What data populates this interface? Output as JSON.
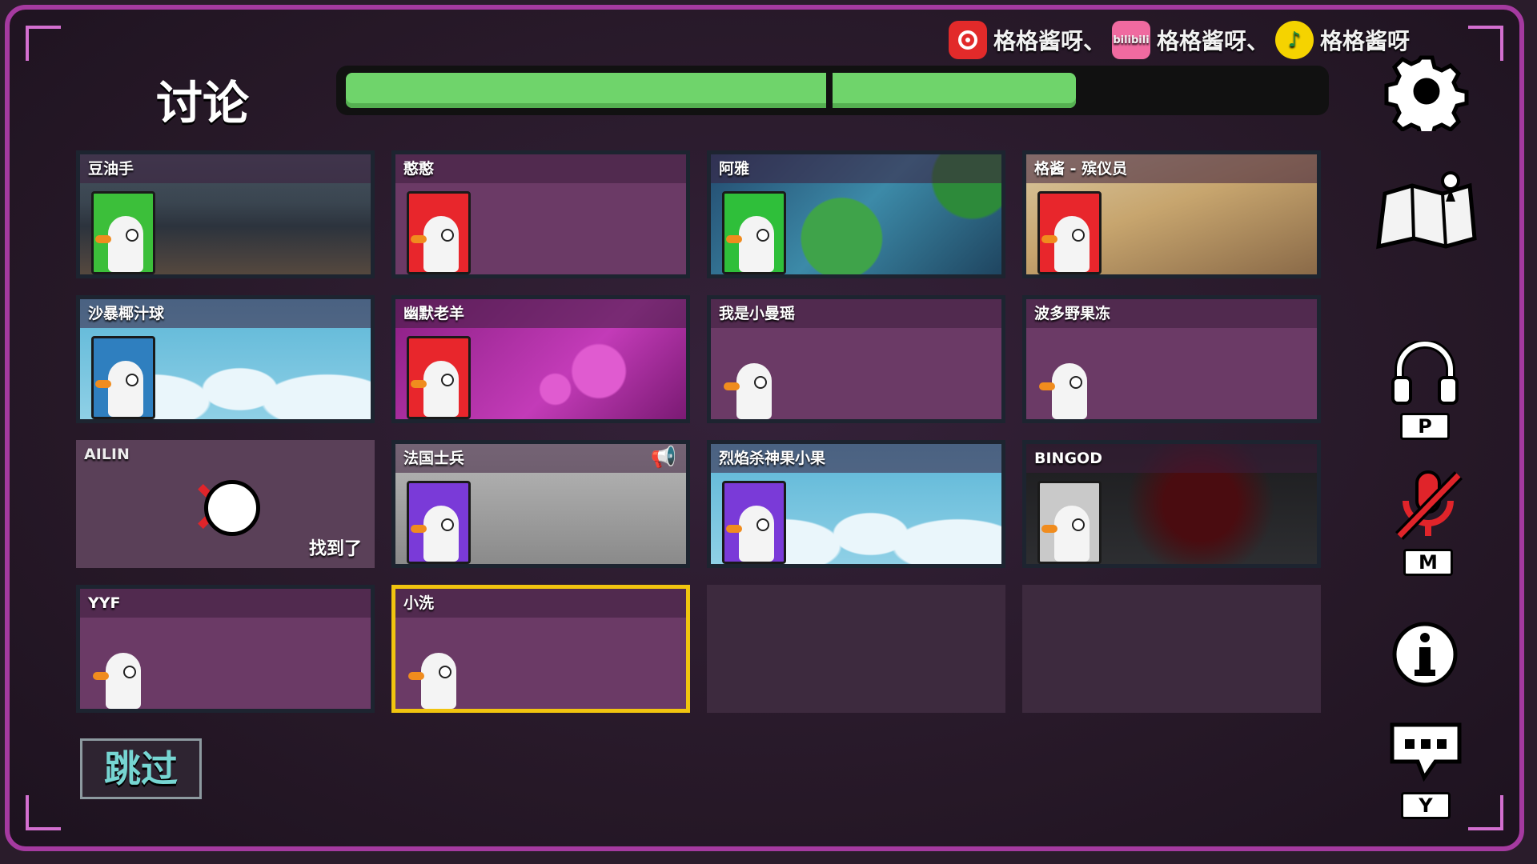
{
  "streamer_bar": {
    "entries": [
      {
        "logo": "netease-music-icon",
        "text": "格格酱呀、"
      },
      {
        "logo": "bilibili-icon",
        "logo_text": "bilibili",
        "text": "格格酱呀、"
      },
      {
        "logo": "qq-music-icon",
        "text": "格格酱呀"
      }
    ]
  },
  "header": {
    "title": "讨论",
    "timer_progress": 0.75
  },
  "players": [
    {
      "name": "豆油手",
      "bg": "room",
      "portrait_color": "#3cbf3a",
      "status": "alive"
    },
    {
      "name": "憨憨",
      "bg": "plain",
      "portrait_color": "#e8262c",
      "status": "alive"
    },
    {
      "name": "阿雅",
      "bg": "pond",
      "portrait_color": "#2fbf3a",
      "status": "alive"
    },
    {
      "name": "格酱 - 殡仪员",
      "bg": "desert",
      "portrait_color": "#e8262c",
      "status": "alive"
    },
    {
      "name": "沙暴椰汁球",
      "bg": "sky",
      "portrait_color": "#2f7fbf",
      "status": "alive"
    },
    {
      "name": "幽默老羊",
      "bg": "hearts",
      "portrait_color": "#e8262c",
      "status": "alive"
    },
    {
      "name": "我是小曼瑶",
      "bg": "plain",
      "portrait_color": "",
      "status": "alive"
    },
    {
      "name": "波多野果冻",
      "bg": "plain",
      "portrait_color": "",
      "status": "alive"
    },
    {
      "name": "AILIN",
      "bg": "dead",
      "portrait_color": "",
      "status": "dead",
      "found_text": "找到了"
    },
    {
      "name": "法国士兵",
      "bg": "cannon",
      "portrait_color": "#7a3ad8",
      "status": "alive",
      "speaking": true
    },
    {
      "name": "烈焰杀神果小果",
      "bg": "sky",
      "portrait_color": "#7a3ad8",
      "status": "alive"
    },
    {
      "name": "BINGOD",
      "bg": "dark",
      "portrait_color": "#c9c9c9",
      "status": "alive"
    },
    {
      "name": "YYF",
      "bg": "plain",
      "portrait_color": "",
      "status": "alive"
    },
    {
      "name": "小洗",
      "bg": "plain",
      "portrait_color": "",
      "status": "alive",
      "selected": true
    },
    {
      "name": "",
      "bg": "empty",
      "status": "empty"
    },
    {
      "name": "",
      "bg": "empty",
      "status": "empty"
    }
  ],
  "skip_button": {
    "label": "跳过"
  },
  "side_controls": [
    {
      "name": "settings-gear-icon",
      "key": ""
    },
    {
      "name": "map-icon",
      "key": ""
    },
    {
      "name": "headphones-icon",
      "key": "P"
    },
    {
      "name": "microphone-muted-icon",
      "key": "M"
    },
    {
      "name": "info-icon",
      "key": ""
    },
    {
      "name": "chat-bubble-icon",
      "key": "Y"
    }
  ],
  "colors": {
    "timer": "#6fd46b",
    "selected_border": "#f1c40f",
    "frame": "#a53aa0",
    "skip_text": "#76d5d2"
  }
}
